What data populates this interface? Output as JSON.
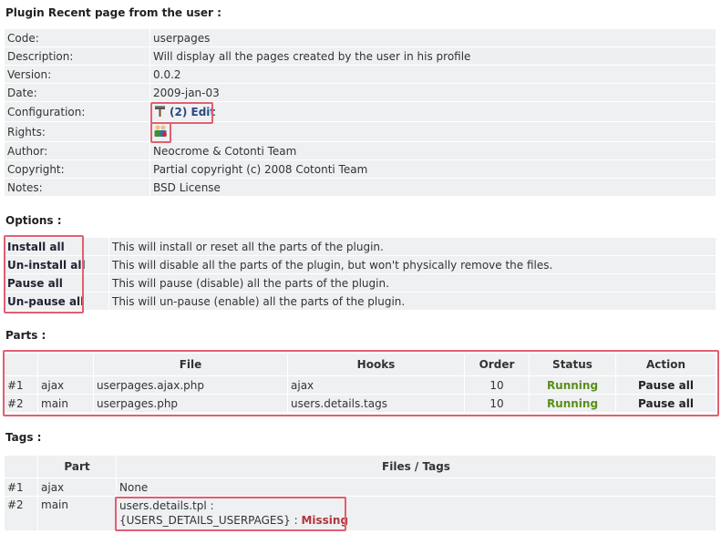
{
  "info": {
    "title": "Plugin Recent page from the user :",
    "rows": {
      "code": {
        "label": "Code:",
        "value": "userpages"
      },
      "description": {
        "label": "Description:",
        "value": "Will display all the pages created by the user in his profile"
      },
      "version": {
        "label": "Version:",
        "value": "0.0.2"
      },
      "date": {
        "label": "Date:",
        "value": "2009-jan-03"
      },
      "configuration": {
        "label": "Configuration:",
        "link": "(2) Edit"
      },
      "rights": {
        "label": "Rights:"
      },
      "author": {
        "label": "Author:",
        "value": "Neocrome & Cotonti Team"
      },
      "copyright": {
        "label": "Copyright:",
        "value": "Partial copyright (c) 2008 Cotonti Team"
      },
      "notes": {
        "label": "Notes:",
        "value": "BSD License"
      }
    }
  },
  "options": {
    "title": "Options :",
    "items": [
      {
        "action": "Install all",
        "desc": "This will install or reset all the parts of the plugin."
      },
      {
        "action": "Un-install all",
        "desc": "This will disable all the parts of the plugin, but won't physically remove the files."
      },
      {
        "action": "Pause all",
        "desc": "This will pause (disable) all the parts of the plugin."
      },
      {
        "action": "Un-pause all",
        "desc": "This will un-pause (enable) all the parts of the plugin."
      }
    ]
  },
  "parts": {
    "title": "Parts :",
    "headers": {
      "file": "File",
      "hooks": "Hooks",
      "order": "Order",
      "status": "Status",
      "action": "Action"
    },
    "rows": [
      {
        "num": "#1",
        "part": "ajax",
        "file": "userpages.ajax.php",
        "hooks": "ajax",
        "order": "10",
        "status": "Running",
        "action": "Pause all"
      },
      {
        "num": "#2",
        "part": "main",
        "file": "userpages.php",
        "hooks": "users.details.tags",
        "order": "10",
        "status": "Running",
        "action": "Pause all"
      }
    ]
  },
  "tags": {
    "title": "Tags :",
    "headers": {
      "part": "Part",
      "files": "Files / Tags"
    },
    "rows": [
      {
        "num": "#1",
        "part": "ajax",
        "files": "None"
      },
      {
        "num": "#2",
        "part": "main",
        "file_line": "users.details.tpl :",
        "tag": "{USERS_DETAILS_USERPAGES} :",
        "status": "Missing"
      }
    ]
  },
  "icons": {
    "config": "hammer-icon",
    "rights": "rights-users-icon"
  },
  "colors": {
    "running": "#5a8f1a",
    "missing": "#b0353d",
    "link": "#2b4a7e",
    "highlight": "#e06070",
    "row_bg": "#eef0f2"
  }
}
